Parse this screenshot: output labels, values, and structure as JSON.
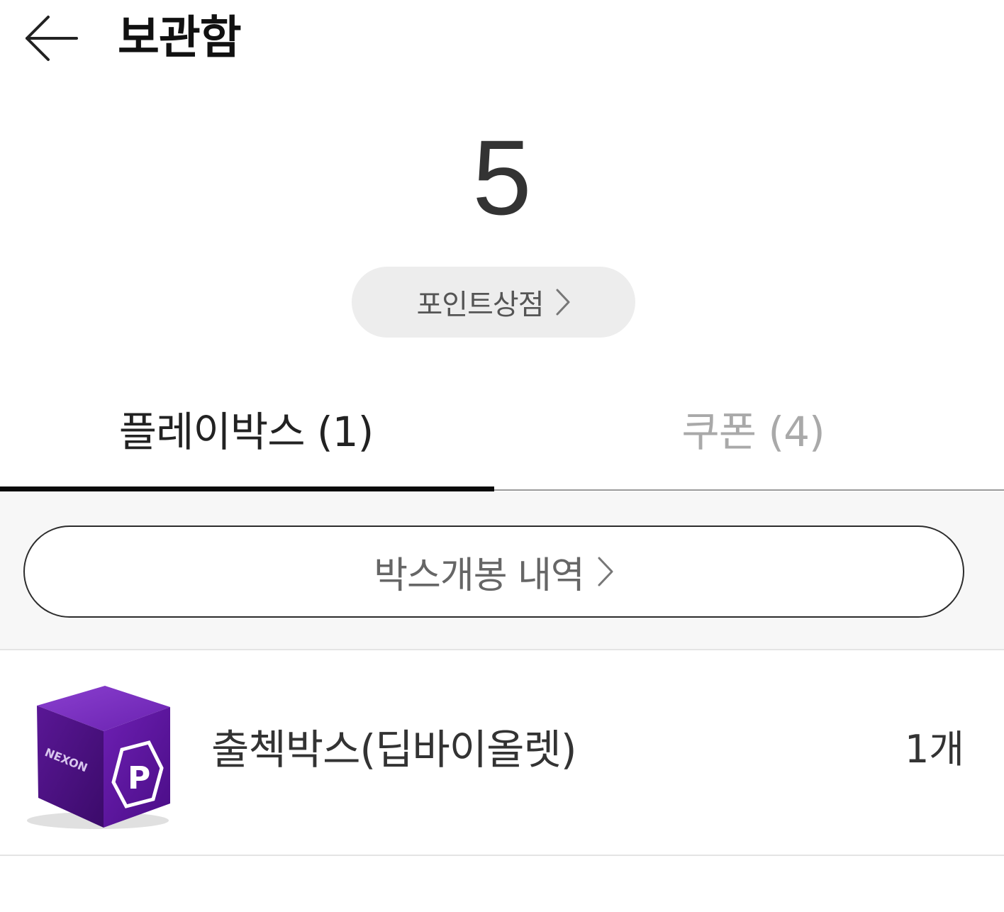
{
  "header": {
    "title": "보관함",
    "back_icon": "arrow-left-icon"
  },
  "points": {
    "value": "5"
  },
  "shop_button": {
    "label": "포인트상점",
    "icon": "chevron-right-icon"
  },
  "tabs": [
    {
      "label": "플레이박스 (1)",
      "active": true
    },
    {
      "label": "쿠폰 (4)",
      "active": false
    }
  ],
  "history_button": {
    "label": "박스개봉 내역",
    "icon": "chevron-right-icon"
  },
  "items": [
    {
      "name": "출첵박스(딥바이올렛)",
      "count": "1개",
      "thumbnail": {
        "icon": "purple-box-icon",
        "brand_text": "NEXON",
        "badge_letter": "P",
        "color": "#5b1aa0"
      }
    }
  ],
  "colors": {
    "active_tab": "#222222",
    "inactive_tab": "#a9a9a9",
    "indicator": "#0a0a0a",
    "shop_button_bg": "#ededed",
    "history_area_bg": "#f7f7f7"
  }
}
